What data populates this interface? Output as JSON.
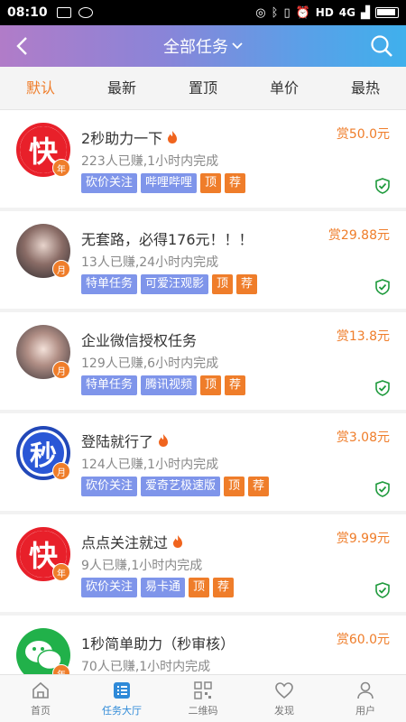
{
  "status_bar": {
    "time": "08:10",
    "network": "HD",
    "signal_type": "4G"
  },
  "header": {
    "title": "全部任务"
  },
  "tabs": [
    {
      "label": "默认",
      "active": true
    },
    {
      "label": "最新",
      "active": false
    },
    {
      "label": "置顶",
      "active": false
    },
    {
      "label": "单价",
      "active": false
    },
    {
      "label": "最热",
      "active": false
    }
  ],
  "tasks": [
    {
      "avatar_text": "快",
      "avatar_style": "kuai",
      "badge": "年",
      "title": "2秒助力一下",
      "hot": true,
      "sub": "223人已赚,1小时内完成",
      "tags": [
        "砍价关注",
        "哔哩哔哩"
      ],
      "top_tag": "顶",
      "rec_tag": "荐",
      "reward": "赏50.0元"
    },
    {
      "avatar_text": "",
      "avatar_style": "photo1",
      "badge": "月",
      "title": "无套路，必得176元！！！",
      "hot": false,
      "sub": "13人已赚,24小时内完成",
      "tags": [
        "特单任务",
        "可爱汪观影"
      ],
      "top_tag": "顶",
      "rec_tag": "荐",
      "reward": "赏29.88元"
    },
    {
      "avatar_text": "",
      "avatar_style": "photo2",
      "badge": "月",
      "title": "企业微信授权任务",
      "hot": false,
      "sub": "129人已赚,6小时内完成",
      "tags": [
        "特单任务",
        "腾讯视频"
      ],
      "top_tag": "顶",
      "rec_tag": "荐",
      "reward": "赏13.8元"
    },
    {
      "avatar_text": "秒",
      "avatar_style": "miao",
      "badge": "月",
      "title": "登陆就行了",
      "hot": true,
      "sub": "124人已赚,1小时内完成",
      "tags": [
        "砍价关注",
        "爱奇艺极速版"
      ],
      "top_tag": "顶",
      "rec_tag": "荐",
      "reward": "赏3.08元"
    },
    {
      "avatar_text": "快",
      "avatar_style": "kuai",
      "badge": "年",
      "title": "点点关注就过",
      "hot": true,
      "sub": "9人已赚,1小时内完成",
      "tags": [
        "砍价关注",
        "易卡通"
      ],
      "top_tag": "顶",
      "rec_tag": "荐",
      "reward": "赏9.99元"
    },
    {
      "avatar_text": "",
      "avatar_style": "wechat",
      "badge": "年",
      "title": "1秒简单助力（秒审核）",
      "hot": false,
      "sub": "70人已赚,1小时内完成",
      "tags": [],
      "top_tag": "",
      "rec_tag": "",
      "reward": "赏60.0元"
    }
  ],
  "tabbar": [
    {
      "label": "首页",
      "icon": "home-icon",
      "active": false
    },
    {
      "label": "任务大厅",
      "icon": "task-list-icon",
      "active": true
    },
    {
      "label": "二维码",
      "icon": "qrcode-icon",
      "active": false
    },
    {
      "label": "发现",
      "icon": "heart-icon",
      "active": false
    },
    {
      "label": "用户",
      "icon": "user-icon",
      "active": false
    }
  ],
  "colors": {
    "accent": "#ef7d2a",
    "tag_blue": "#7f95ea",
    "active_tab_bar": "#2f8ad8"
  }
}
